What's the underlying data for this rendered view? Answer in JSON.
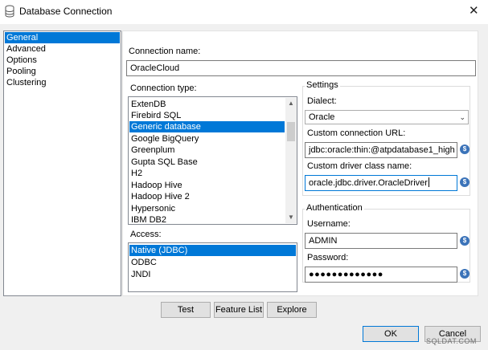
{
  "window": {
    "title": "Database Connection",
    "icon": "database-icon",
    "close_glyph": "✕"
  },
  "nav": {
    "items": [
      {
        "label": "General",
        "selected": true
      },
      {
        "label": "Advanced",
        "selected": false
      },
      {
        "label": "Options",
        "selected": false
      },
      {
        "label": "Pooling",
        "selected": false
      },
      {
        "label": "Clustering",
        "selected": false
      }
    ]
  },
  "connection_name": {
    "label": "Connection name:",
    "value": "OracleCloud"
  },
  "connection_type": {
    "label": "Connection type:",
    "items": [
      {
        "label": "ExtenDB",
        "selected": false
      },
      {
        "label": "Firebird SQL",
        "selected": false
      },
      {
        "label": "Generic database",
        "selected": true
      },
      {
        "label": "Google BigQuery",
        "selected": false
      },
      {
        "label": "Greenplum",
        "selected": false
      },
      {
        "label": "Gupta SQL Base",
        "selected": false
      },
      {
        "label": "H2",
        "selected": false
      },
      {
        "label": "Hadoop Hive",
        "selected": false
      },
      {
        "label": "Hadoop Hive 2",
        "selected": false
      },
      {
        "label": "Hypersonic",
        "selected": false
      },
      {
        "label": "IBM DB2",
        "selected": false
      }
    ]
  },
  "access": {
    "label": "Access:",
    "items": [
      {
        "label": "Native (JDBC)",
        "selected": true
      },
      {
        "label": "ODBC",
        "selected": false
      },
      {
        "label": "JNDI",
        "selected": false
      }
    ]
  },
  "settings": {
    "title": "Settings",
    "dialect_label": "Dialect:",
    "dialect_value": "Oracle",
    "url_label": "Custom connection URL:",
    "url_value": "jdbc:oracle:thin:@atpdatabase1_high",
    "driver_label": "Custom driver class name:",
    "driver_value": "oracle.jdbc.driver.OracleDriver"
  },
  "authentication": {
    "title": "Authentication",
    "username_label": "Username:",
    "username_value": "ADMIN",
    "password_label": "Password:",
    "password_value": "●●●●●●●●●●●●●"
  },
  "buttons": {
    "test": "Test",
    "feature_list": "Feature List",
    "explore": "Explore",
    "ok": "OK",
    "cancel": "Cancel"
  },
  "watermark": "SQLDAT.COM",
  "colors": {
    "selection": "#0078d7",
    "dialog_bg": "#f0f0f0",
    "variable_icon": "#3b73b9"
  }
}
